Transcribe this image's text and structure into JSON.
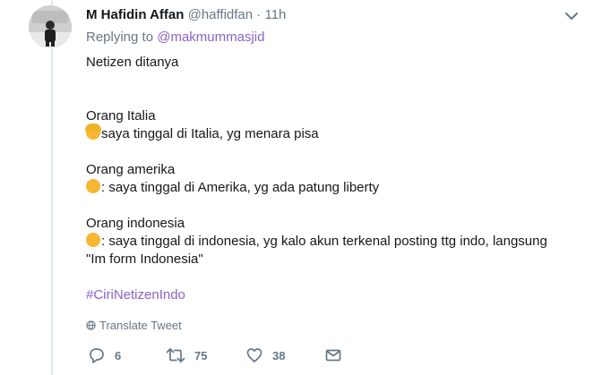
{
  "tweet": {
    "author_name": "M Hafidin Affan",
    "author_handle": "@haffidfan",
    "separator": "·",
    "time": "11h",
    "replying_prefix": "Replying to",
    "replying_to": "@makmummasjid",
    "lines": {
      "l1": "Netizen ditanya",
      "l2": "Orang Italia",
      "l3": "saya  tinggal di Italia, yg menara pisa",
      "l4": "Orang amerika",
      "l5": ": saya tinggal di Amerika, yg ada patung liberty",
      "l6": "Orang indonesia",
      "l7": ": saya tinggal di indonesia,  yg kalo akun terkenal posting ttg indo,  langsung",
      "l8": "\"Im form Indonesia\""
    },
    "hashtag": "#CiriNetizenIndo",
    "translate_label": "Translate Tweet",
    "actions": {
      "reply_count": "6",
      "retweet_count": "75",
      "like_count": "38"
    }
  },
  "icons": {
    "caret": "chevron-down-icon",
    "globe": "globe-icon",
    "reply": "reply-icon",
    "retweet": "retweet-icon",
    "like": "heart-icon",
    "dm": "envelope-icon",
    "emoji": "person-emoji-icon"
  },
  "colors": {
    "link": "#8a63c9",
    "secondary_text": "#657786",
    "thread_line": "#e1e8ed"
  }
}
